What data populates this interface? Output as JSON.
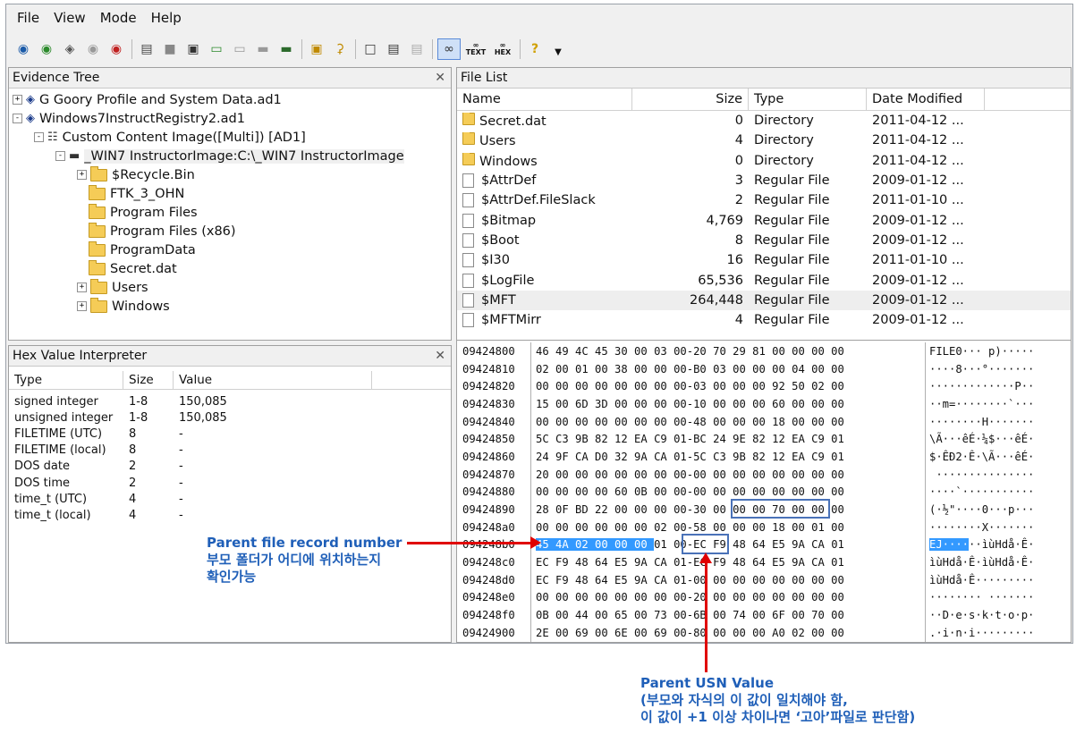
{
  "menu": [
    "File",
    "View",
    "Mode",
    "Help"
  ],
  "toolbar_icons": [
    "add-evidence-icon",
    "add-all-evidence-icon",
    "image-mounting-icon",
    "remove-evidence-icon",
    "remove-all-icon",
    "create-disk-image-icon",
    "export-disk-image-icon",
    "capture-memory-icon",
    "obtain-protected-files-icon",
    "detect-encryption-icon",
    "export-files-icon",
    "verify-drive-icon",
    "decrypt-icon",
    "properties-icon",
    "show-file-list-icon",
    "report-icon",
    "dir-icon",
    "auto-view-icon",
    "text-view-icon",
    "hex-view-icon",
    "help-icon",
    "overflow-icon"
  ],
  "toolbar_text": {
    "text": "TEXT",
    "hex": "HEX"
  },
  "evidence_tree": {
    "title": "Evidence Tree",
    "items": [
      {
        "label": "G Goory Profile and System Data.ad1",
        "expander": "+"
      },
      {
        "label": "Windows7InstructRegistry2.ad1",
        "expander": "-"
      },
      {
        "label": "Custom Content Image([Multi]) [AD1]",
        "expander": "-"
      },
      {
        "label": "_WIN7 InstructorImage:C:\\_WIN7 InstructorImage",
        "expander": "-"
      },
      {
        "label": "$Recycle.Bin",
        "expander": "+"
      },
      {
        "label": "FTK_3_OHN",
        "expander": ""
      },
      {
        "label": "Program Files",
        "expander": ""
      },
      {
        "label": "Program Files (x86)",
        "expander": ""
      },
      {
        "label": "ProgramData",
        "expander": ""
      },
      {
        "label": "Secret.dat",
        "expander": ""
      },
      {
        "label": "Users",
        "expander": "+"
      },
      {
        "label": "Windows",
        "expander": "+"
      }
    ]
  },
  "file_list": {
    "title": "File List",
    "columns": [
      "Name",
      "Size",
      "Type",
      "Date Modified"
    ],
    "rows": [
      {
        "name": "Secret.dat",
        "size": "0",
        "type": "Directory",
        "date": "2011-04-12 ...",
        "folder": true
      },
      {
        "name": "Users",
        "size": "4",
        "type": "Directory",
        "date": "2011-04-12 ...",
        "folder": true
      },
      {
        "name": "Windows",
        "size": "0",
        "type": "Directory",
        "date": "2011-04-12 ...",
        "folder": true
      },
      {
        "name": "$AttrDef",
        "size": "3",
        "type": "Regular File",
        "date": "2009-01-12 ...",
        "folder": false
      },
      {
        "name": "$AttrDef.FileSlack",
        "size": "2",
        "type": "Regular File",
        "date": "2011-01-10 ...",
        "folder": false
      },
      {
        "name": "$Bitmap",
        "size": "4,769",
        "type": "Regular File",
        "date": "2009-01-12 ...",
        "folder": false
      },
      {
        "name": "$Boot",
        "size": "8",
        "type": "Regular File",
        "date": "2009-01-12 ...",
        "folder": false
      },
      {
        "name": "$I30",
        "size": "16",
        "type": "Regular File",
        "date": "2011-01-10 ...",
        "folder": false
      },
      {
        "name": "$LogFile",
        "size": "65,536",
        "type": "Regular File",
        "date": "2009-01-12 ...",
        "folder": false
      },
      {
        "name": "$MFT",
        "size": "264,448",
        "type": "Regular File",
        "date": "2009-01-12 ...",
        "folder": false,
        "selected": true
      },
      {
        "name": "$MFTMirr",
        "size": "4",
        "type": "Regular File",
        "date": "2009-01-12 ...",
        "folder": false
      }
    ]
  },
  "hex_interpreter": {
    "title": "Hex Value Interpreter",
    "columns": [
      "Type",
      "Size",
      "Value"
    ],
    "rows": [
      {
        "type": "signed integer",
        "size": "1-8",
        "value": "150,085"
      },
      {
        "type": "unsigned integer",
        "size": "1-8",
        "value": "150,085"
      },
      {
        "type": "FILETIME (UTC)",
        "size": "8",
        "value": "-"
      },
      {
        "type": "FILETIME (local)",
        "size": "8",
        "value": "-"
      },
      {
        "type": "DOS date",
        "size": "2",
        "value": "-"
      },
      {
        "type": "DOS time",
        "size": "2",
        "value": "-"
      },
      {
        "type": "time_t (UTC)",
        "size": "4",
        "value": "-"
      },
      {
        "type": "time_t (local)",
        "size": "4",
        "value": "-"
      }
    ]
  },
  "hex_view": {
    "rows": [
      {
        "offset": "09424800",
        "bytes": "46 49 4C 45 30 00 03 00-20 70 29 81 00 00 00 00",
        "ascii": "FILE0··· p)·····"
      },
      {
        "offset": "09424810",
        "bytes": "02 00 01 00 38 00 00 00-B0 03 00 00 00 04 00 00",
        "ascii": "····8···°·······"
      },
      {
        "offset": "09424820",
        "bytes": "00 00 00 00 00 00 00 00-03 00 00 00 92 50 02 00",
        "ascii": "·············P··"
      },
      {
        "offset": "09424830",
        "bytes": "15 00 6D 3D 00 00 00 00-10 00 00 00 60 00 00 00",
        "ascii": "··m=········`···"
      },
      {
        "offset": "09424840",
        "bytes": "00 00 00 00 00 00 00 00-48 00 00 00 18 00 00 00",
        "ascii": "········H·······"
      },
      {
        "offset": "09424850",
        "bytes": "5C C3 9B 82 12 EA C9 01-BC 24 9E 82 12 EA C9 01",
        "ascii": "\\Ã···êÉ·¼$···êÉ·"
      },
      {
        "offset": "09424860",
        "bytes": "24 9F CA D0 32 9A CA 01-5C C3 9B 82 12 EA C9 01",
        "ascii": "$·ÊÐ2·Ê·\\Ã···êÉ·"
      },
      {
        "offset": "09424870",
        "bytes": "20 00 00 00 00 00 00 00-00 00 00 00 00 00 00 00",
        "ascii": " ···············"
      },
      {
        "offset": "09424880",
        "bytes": "00 00 00 00 60 0B 00 00-00 00 00 00 00 00 00 00",
        "ascii": "····`···········"
      },
      {
        "offset": "09424890",
        "bytes": "28 0F BD 22 00 00 00 00-30 00 00 00 70 00 00 00",
        "ascii": "(·½\"····0···p···"
      },
      {
        "offset": "094248a0",
        "bytes": "00 00 00 00 00 00 02 00-58 00 00 00 18 00 01 00",
        "ascii": "········X·······"
      },
      {
        "offset": "094248b0",
        "bytes": "45 4A 02 00 00 00 01 00-EC F9 48 64 E5 9A CA 01",
        "ascii": "EJ······ìùHdå·Ê·"
      },
      {
        "offset": "094248c0",
        "bytes": "EC F9 48 64 E5 9A CA 01-EC F9 48 64 E5 9A CA 01",
        "ascii": "ìùHdå·Ê·ìùHdå·Ê·"
      },
      {
        "offset": "094248d0",
        "bytes": "EC F9 48 64 E5 9A CA 01-00 00 00 00 00 00 00 00",
        "ascii": "ìùHdå·Ê·········"
      },
      {
        "offset": "094248e0",
        "bytes": "00 00 00 00 00 00 00 00-20 00 00 00 00 00 00 00",
        "ascii": "········ ·······"
      },
      {
        "offset": "094248f0",
        "bytes": "0B 00 44 00 65 00 73 00-6B 00 74 00 6F 00 70 00",
        "ascii": "··D·e·s·k·t·o·p·"
      },
      {
        "offset": "09424900",
        "bytes": "2E 00 69 00 6E 00 69 00-80 00 00 00 A0 02 00 00",
        "ascii": ".·i·n·i·········"
      }
    ]
  },
  "annotations": {
    "parent_record": {
      "title": "Parent file record number",
      "line1": "부모 폴더가 어디에 위치하는지",
      "line2": "확인가능"
    },
    "parent_usn": {
      "title": "Parent USN Value",
      "line1": "(부모와 자식의 이 값이 일치해야 함,",
      "line2": "이 값이 +1 이상 차이나면 ‘고아’파일로 판단함)"
    },
    "colors": {
      "note": "#1f5fb8",
      "arrow": "#e00000",
      "box": "#4a72b8",
      "selection": "#3399ff"
    }
  }
}
